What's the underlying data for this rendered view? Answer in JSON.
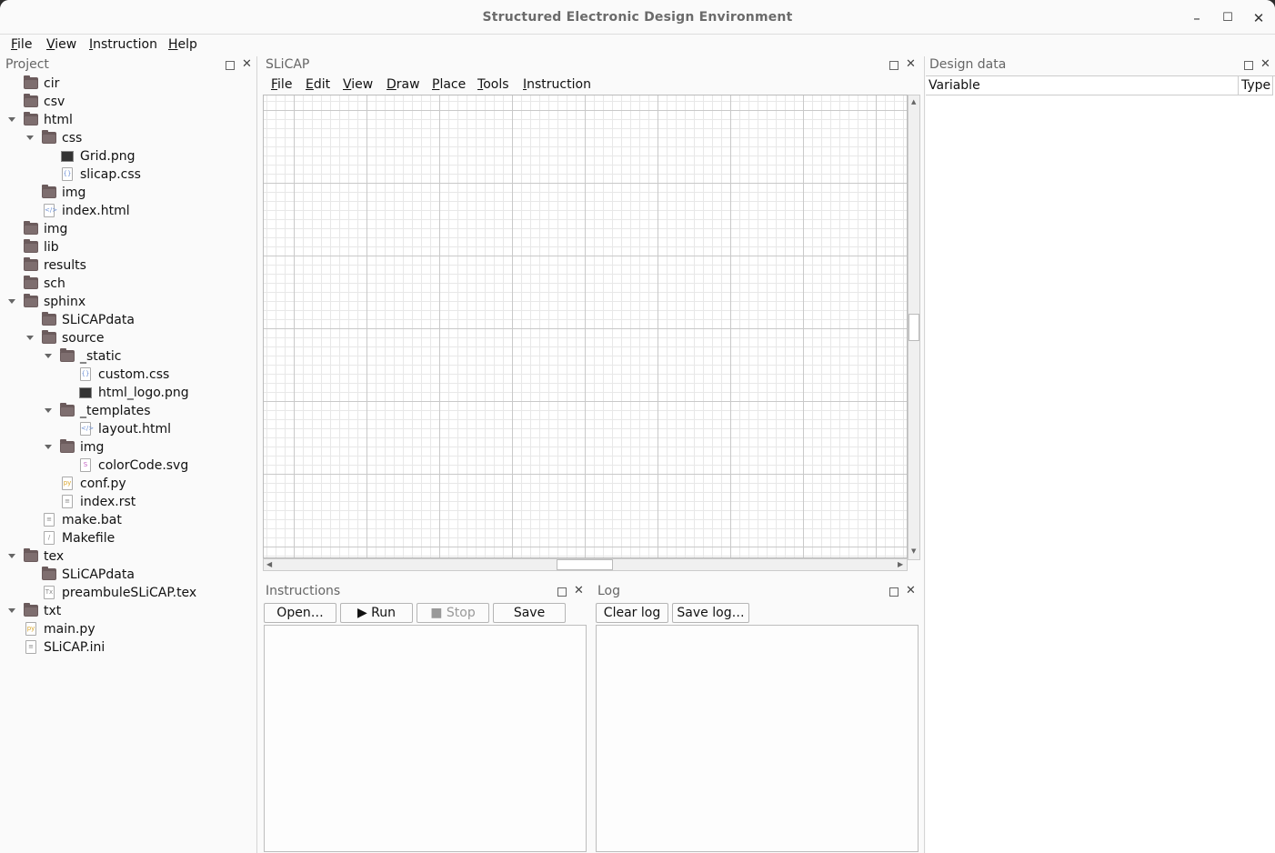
{
  "window": {
    "title": "Structured Electronic Design Environment"
  },
  "menubar": [
    {
      "label": "File",
      "u": "F",
      "rest": "ile"
    },
    {
      "label": "View",
      "u": "V",
      "rest": "iew"
    },
    {
      "label": "Instruction",
      "u": "I",
      "rest": "nstruction"
    },
    {
      "label": "Help",
      "u": "H",
      "rest": "elp"
    }
  ],
  "project": {
    "title": "Project",
    "tree": [
      {
        "label": "cir",
        "depth": 0,
        "kind": "folder",
        "expanded": false
      },
      {
        "label": "csv",
        "depth": 0,
        "kind": "folder",
        "expanded": false
      },
      {
        "label": "html",
        "depth": 0,
        "kind": "folder",
        "expanded": true
      },
      {
        "label": "css",
        "depth": 1,
        "kind": "folder",
        "expanded": true
      },
      {
        "label": "Grid.png",
        "depth": 2,
        "kind": "image"
      },
      {
        "label": "slicap.css",
        "depth": 2,
        "kind": "css"
      },
      {
        "label": "img",
        "depth": 1,
        "kind": "folder",
        "expanded": false
      },
      {
        "label": "index.html",
        "depth": 1,
        "kind": "html"
      },
      {
        "label": "img",
        "depth": 0,
        "kind": "folder",
        "expanded": false
      },
      {
        "label": "lib",
        "depth": 0,
        "kind": "folder",
        "expanded": false
      },
      {
        "label": "results",
        "depth": 0,
        "kind": "folder",
        "expanded": false
      },
      {
        "label": "sch",
        "depth": 0,
        "kind": "folder",
        "expanded": false
      },
      {
        "label": "sphinx",
        "depth": 0,
        "kind": "folder",
        "expanded": true
      },
      {
        "label": "SLiCAPdata",
        "depth": 1,
        "kind": "folder",
        "expanded": false
      },
      {
        "label": "source",
        "depth": 1,
        "kind": "folder",
        "expanded": true
      },
      {
        "label": "_static",
        "depth": 2,
        "kind": "folder",
        "expanded": true
      },
      {
        "label": "custom.css",
        "depth": 3,
        "kind": "css"
      },
      {
        "label": "html_logo.png",
        "depth": 3,
        "kind": "image"
      },
      {
        "label": "_templates",
        "depth": 2,
        "kind": "folder",
        "expanded": true
      },
      {
        "label": "layout.html",
        "depth": 3,
        "kind": "html"
      },
      {
        "label": "img",
        "depth": 2,
        "kind": "folder",
        "expanded": true
      },
      {
        "label": "colorCode.svg",
        "depth": 3,
        "kind": "svg"
      },
      {
        "label": "conf.py",
        "depth": 2,
        "kind": "python"
      },
      {
        "label": "index.rst",
        "depth": 2,
        "kind": "text"
      },
      {
        "label": "make.bat",
        "depth": 1,
        "kind": "text"
      },
      {
        "label": "Makefile",
        "depth": 1,
        "kind": "script"
      },
      {
        "label": "tex",
        "depth": 0,
        "kind": "folder",
        "expanded": true
      },
      {
        "label": "SLiCAPdata",
        "depth": 1,
        "kind": "folder",
        "expanded": false
      },
      {
        "label": "preambuleSLiCAP.tex",
        "depth": 1,
        "kind": "tex"
      },
      {
        "label": "txt",
        "depth": 0,
        "kind": "folder",
        "expanded": true
      },
      {
        "label": "main.py",
        "depth": 0,
        "kind": "python"
      },
      {
        "label": "SLiCAP.ini",
        "depth": 0,
        "kind": "text"
      }
    ]
  },
  "slicap": {
    "title": "SLiCAP",
    "menu": [
      {
        "u": "F",
        "rest": "ile"
      },
      {
        "u": "E",
        "rest": "dit"
      },
      {
        "u": "V",
        "rest": "iew"
      },
      {
        "u": "D",
        "rest": "raw"
      },
      {
        "u": "P",
        "rest": "lace"
      },
      {
        "u": "T",
        "rest": "ools"
      },
      {
        "u": "I",
        "rest": "nstruction"
      }
    ]
  },
  "instructions": {
    "title": "Instructions",
    "open_label": "Open…",
    "run_label": "▶ Run",
    "stop_label": "■ Stop",
    "save_label": "Save"
  },
  "log": {
    "title": "Log",
    "clear_label": "Clear log",
    "save_label": "Save log…"
  },
  "design_data": {
    "title": "Design data",
    "columns": [
      "Variable",
      "Type"
    ]
  },
  "icons": [
    "minimize-icon",
    "maximize-icon",
    "close-icon",
    "float-icon",
    "folder-icon",
    "file-icon",
    "image-file-icon",
    "python-file-icon",
    "svg-file-icon"
  ],
  "colors": {
    "folder": "#6b5b5c",
    "background": "#fafafa",
    "grid_major": "#c9c9c9",
    "grid_minor": "#e8e8e8"
  }
}
